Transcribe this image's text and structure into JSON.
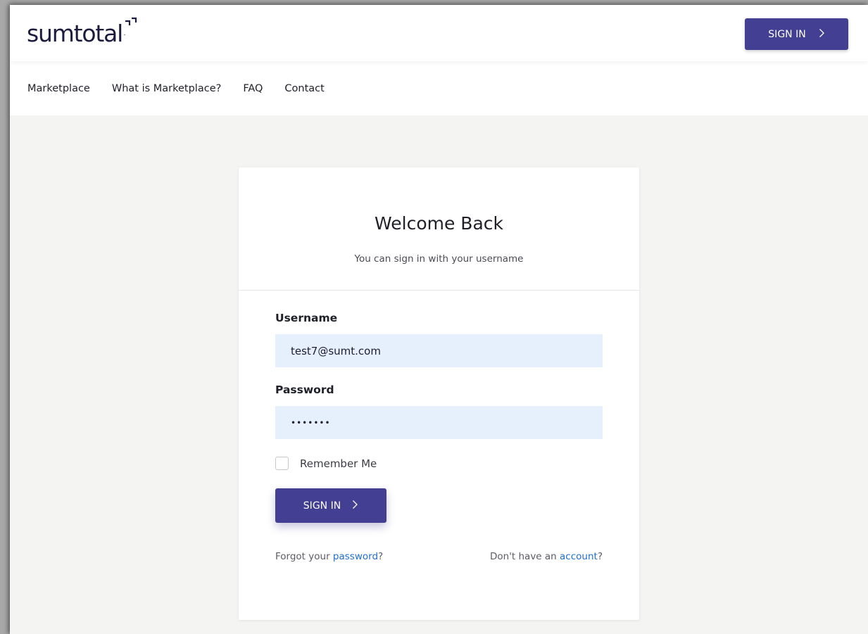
{
  "header": {
    "logo_text": "sumtotal",
    "signin_label": "SIGN IN",
    "signin_icon": "chevron-right-icon"
  },
  "nav": {
    "items": [
      "Marketplace",
      "What is Marketplace?",
      "FAQ",
      "Contact"
    ]
  },
  "card": {
    "title": "Welcome Back",
    "subtitle": "You can sign in with your username"
  },
  "form": {
    "username_label": "Username",
    "username_value": "test7@sumt.com",
    "password_label": "Password",
    "password_value": "•••••••",
    "remember_label": "Remember Me",
    "remember_checked": false,
    "signin_label": "SIGN IN",
    "signin_icon": "chevron-right-icon"
  },
  "links": {
    "forgot_prefix": "Forgot your ",
    "forgot_link": "password",
    "forgot_suffix": "?",
    "account_prefix": "Don't have an ",
    "account_link": "account",
    "account_suffix": "?"
  },
  "colors": {
    "brand": "#433f93",
    "logo": "#1a1b3f",
    "link": "#1f6fd1",
    "field_bg": "#e6f0fd",
    "page_bg": "#f4f4f3"
  }
}
